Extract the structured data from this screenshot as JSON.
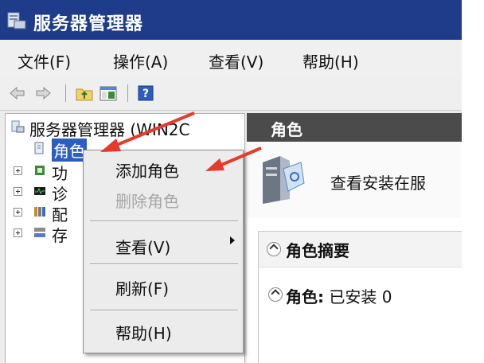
{
  "window": {
    "title": "服务器管理器"
  },
  "menubar": {
    "items": [
      "文件(F)",
      "操作(A)",
      "查看(V)",
      "帮助(H)"
    ]
  },
  "toolbar": {
    "buttons": [
      "back-icon",
      "forward-icon",
      "up-folder-icon",
      "show-hide-tree-icon",
      "help-icon"
    ]
  },
  "tree": {
    "root": "服务器管理器 (WIN2C",
    "items": [
      {
        "label": "角色",
        "selected": true
      },
      {
        "label": "功"
      },
      {
        "label": "诊"
      },
      {
        "label": "配"
      },
      {
        "label": "存"
      }
    ]
  },
  "right_pane": {
    "header": "角色",
    "banner_text": "查看安装在服",
    "section_title": "角色摘要",
    "row_label": "角色:",
    "row_value": "已安装 0"
  },
  "context_menu": {
    "items": [
      {
        "label": "添加角色",
        "enabled": true
      },
      {
        "label": "删除角色",
        "enabled": false
      },
      {
        "label": "查看(V)",
        "enabled": true,
        "submenu": true
      },
      {
        "label": "刷新(F)",
        "enabled": true
      },
      {
        "label": "帮助(H)",
        "enabled": true
      }
    ]
  },
  "colors": {
    "titlebar": "#1e3c8a",
    "selection": "#2c5dbf",
    "pane_header": "#4b4b4b",
    "annotation_arrow": "#e53b2c"
  }
}
